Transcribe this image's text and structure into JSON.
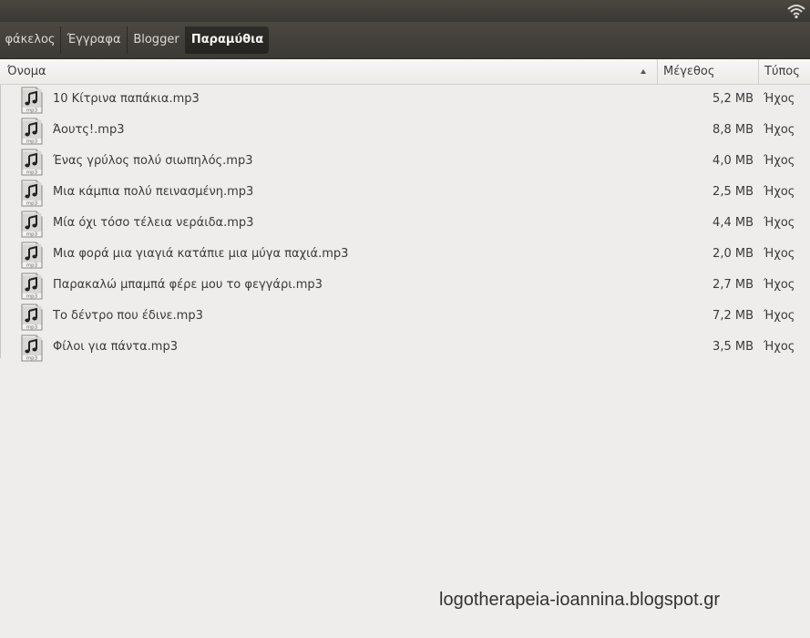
{
  "breadcrumbs": [
    {
      "label": "φάκελος"
    },
    {
      "label": "Έγγραφα"
    },
    {
      "label": "Blogger"
    },
    {
      "label": "Παραμύθια"
    }
  ],
  "columns": {
    "name": "Όνομα",
    "size": "Μέγεθος",
    "type": "Τύπος"
  },
  "files": [
    {
      "name": "10 Κίτρινα παπάκια.mp3",
      "size": "5,2 MB",
      "type": "Ήχος"
    },
    {
      "name": "Άουτς!.mp3",
      "size": "8,8 MB",
      "type": "Ήχος"
    },
    {
      "name": "Ένας γρύλος πολύ σιωπηλός.mp3",
      "size": "4,0 MB",
      "type": "Ήχος"
    },
    {
      "name": "Μια κάμπια πολύ πεινασμένη.mp3",
      "size": "2,5 MB",
      "type": "Ήχος"
    },
    {
      "name": "Μία όχι τόσο τέλεια νεράιδα.mp3",
      "size": "4,4 MB",
      "type": "Ήχος"
    },
    {
      "name": "Μια φορά μια γιαγιά κατάπιε μια μύγα παχιά.mp3",
      "size": "2,0 MB",
      "type": "Ήχος"
    },
    {
      "name": "Παρακαλώ μπαμπά φέρε μου το φεγγάρι.mp3",
      "size": "2,7 MB",
      "type": "Ήχος"
    },
    {
      "name": "Το δέντρο που έδινε.mp3",
      "size": "7,2 MB",
      "type": "Ήχος"
    },
    {
      "name": "Φίλοι για πάντα.mp3",
      "size": "3,5 MB",
      "type": "Ήχος"
    }
  ],
  "icon_label": "mp3",
  "watermark": "logotherapeia-ioannina.blogspot.gr",
  "icons": {
    "topbar": "wifi-icon",
    "file": "audio-file-icon",
    "sort": "sort-ascending-icon"
  }
}
